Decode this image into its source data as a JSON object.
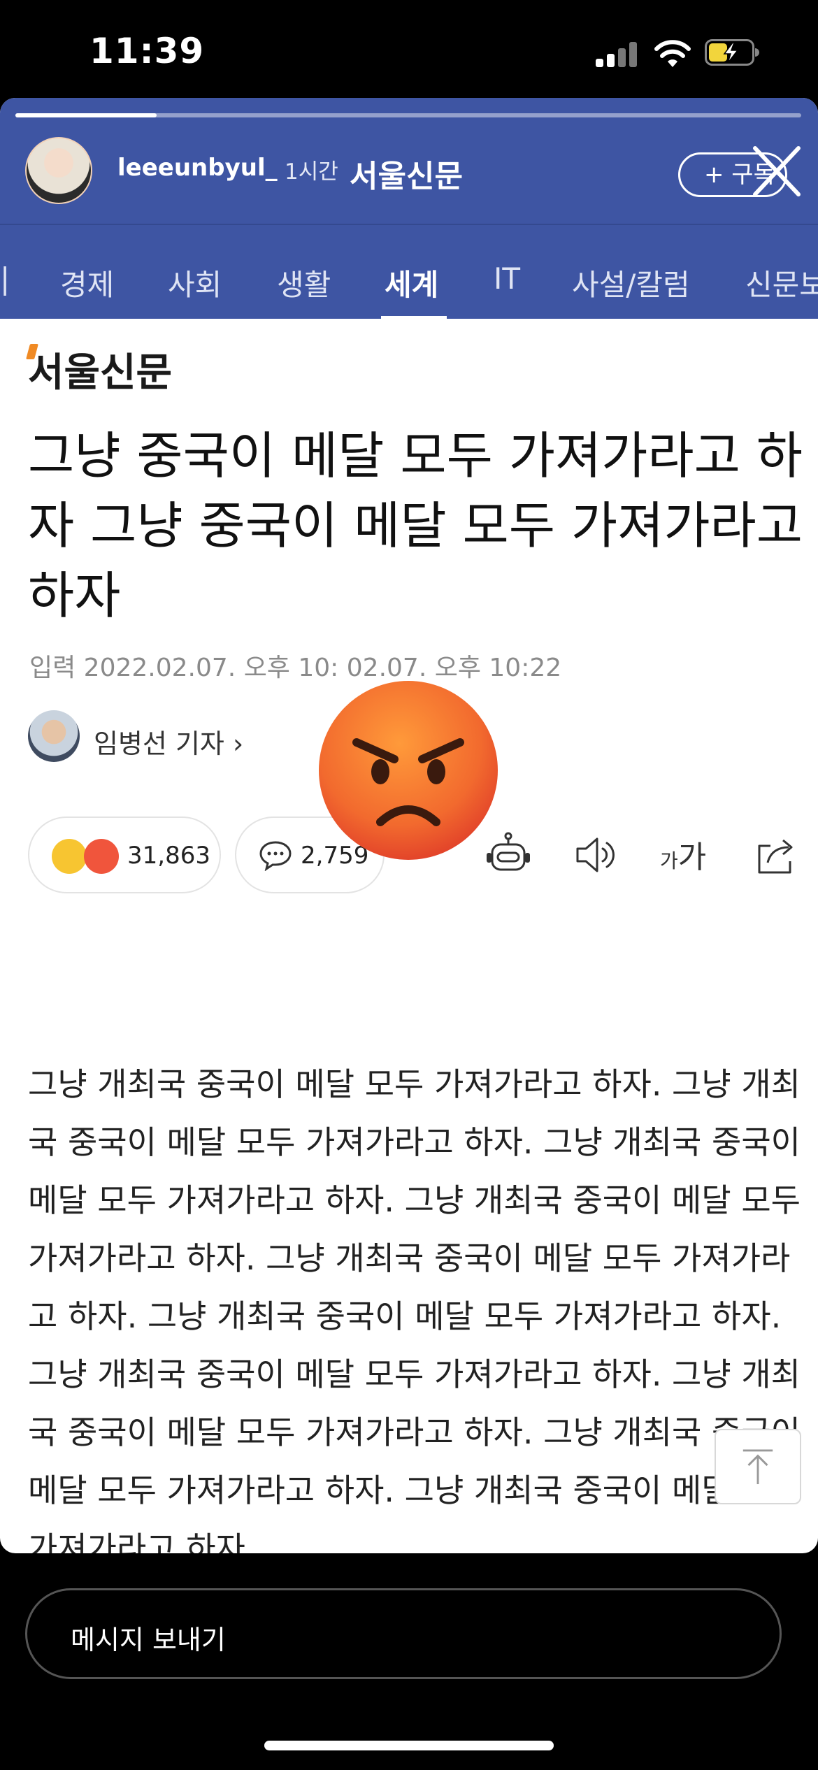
{
  "status_bar": {
    "time": "11:39"
  },
  "story": {
    "progress": 0.18,
    "username": "leeeunbyul_",
    "time_ago": "1시간",
    "brand": "서울신문",
    "subscribe_label": "+ 구독"
  },
  "tabs": [
    {
      "label": "|"
    },
    {
      "label": "경제"
    },
    {
      "label": "사회"
    },
    {
      "label": "생활"
    },
    {
      "label": "세계"
    },
    {
      "label": "IT"
    },
    {
      "label": "사설/칼럼"
    },
    {
      "label": "신문보"
    }
  ],
  "active_tab": "세계",
  "article": {
    "logo": "서울신문",
    "headline": "그냥 중국이 메달 모두 가져가라고 하자 그냥 중국이 메달 모두 가져가라고 하자",
    "dateline": "입력 2022.02.07. 오후 10:  02.07. 오후 10:22",
    "reporter": "임병선 기자 ›",
    "reaction_count": "31,863",
    "comment_count": "2,759",
    "fontsize_small": "가",
    "fontsize_big": "가",
    "body": "그냥 개최국 중국이 메달 모두 가져가라고 하자. 그냥 개최국 중국이 메달 모두 가져가라고 하자. 그냥 개최국 중국이 메달 모두 가져가라고 하자. 그냥 개최국 중국이 메달 모두 가져가라고 하자. 그냥 개최국 중국이 메달 모두 가져가라고 하자. 그냥 개최국 중국이 메달 모두 가져가라고 하자. 그냥 개최국 중국이 메달 모두 가져가라고 하자. 그냥 개최국 중국이 메달 모두 가져가라고 하자. 그냥 개최국 중국이 메달 모두 가져가라고 하자. 그냥 개최국 중국이 메달 모두 가져가라고 하자."
  },
  "message_placeholder": "메시지 보내기",
  "colors": {
    "header_blue": "#3e55a3",
    "logo_accent": "#f08a24",
    "angry_orange": "#f26a2e"
  }
}
